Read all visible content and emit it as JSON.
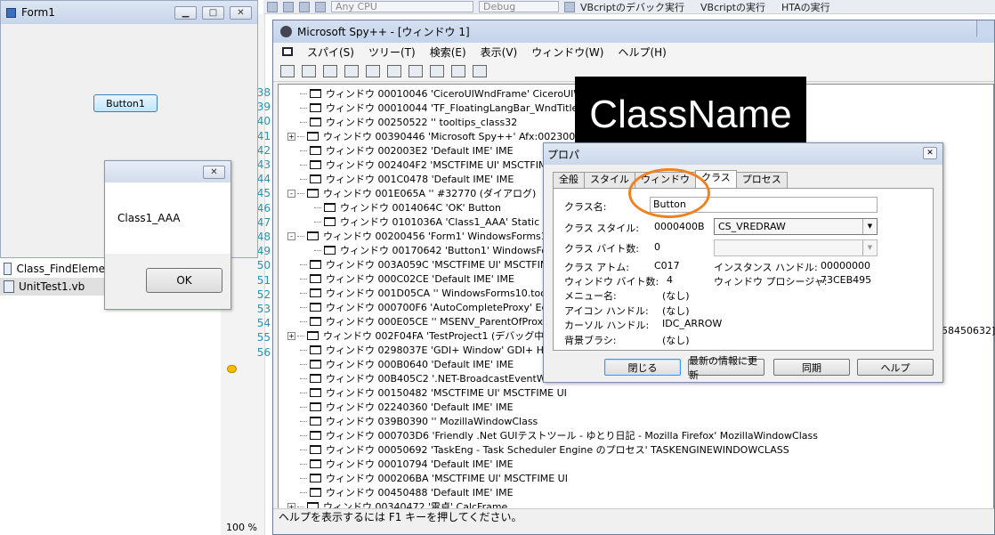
{
  "vs_toolbar": {
    "platform_combo": "Any CPU",
    "config_combo": "Debug",
    "commands": [
      "VBcriptのデバック実行",
      "VBcriptの実行",
      "HTAの実行"
    ]
  },
  "editor": {
    "line_numbers": [
      "38",
      "39",
      "40",
      "41",
      "42",
      "43",
      "44",
      "45",
      "46",
      "47",
      "48",
      "49",
      "50",
      "51",
      "52",
      "53",
      "54",
      "55",
      "56"
    ],
    "zoom": "100 %"
  },
  "form1": {
    "title": "Form1",
    "button_label": "Button1"
  },
  "solution": {
    "items": [
      "Class_FindEleme",
      "UnitTest1.vb"
    ]
  },
  "msgbox": {
    "message": "Class1_AAA",
    "ok_label": "OK"
  },
  "spy": {
    "title": "Microsoft Spy++ - [ウィンドウ 1]",
    "menu": [
      "スパイ(S)",
      "ツリー(T)",
      "検索(E)",
      "表示(V)",
      "ウィンドウ(W)",
      "ヘルプ(H)"
    ],
    "tree": [
      {
        "exp": "",
        "indent": 0,
        "text": "ウィンドウ 00010046 'CiceroUIWndFrame' CiceroUIWndF"
      },
      {
        "exp": "",
        "indent": 0,
        "text": "ウィンドウ 00010044 'TF_FloatingLangBar_WndTitle' Cic"
      },
      {
        "exp": "",
        "indent": 0,
        "text": "ウィンドウ 00250522 '' tooltips_class32"
      },
      {
        "exp": "+",
        "indent": 0,
        "text": "ウィンドウ 00390446 'Microsoft Spy++' Afx:00230000:8:0"
      },
      {
        "exp": "",
        "indent": 0,
        "text": "ウィンドウ 002003E2 'Default IME' IME"
      },
      {
        "exp": "",
        "indent": 0,
        "text": "ウィンドウ 002404F2 'MSCTFIME UI' MSCTFIME"
      },
      {
        "exp": "",
        "indent": 0,
        "text": "ウィンドウ 001C0478 'Default IME' IME"
      },
      {
        "exp": "-",
        "indent": 0,
        "text": "ウィンドウ 001E065A '' #32770 (ダイアログ)"
      },
      {
        "exp": "",
        "indent": 1,
        "text": "ウィンドウ 0014064C 'OK' Button"
      },
      {
        "exp": "",
        "indent": 1,
        "text": "ウィンドウ 0101036A 'Class1_AAA' Static"
      },
      {
        "exp": "-",
        "indent": 0,
        "text": "ウィンドウ 00200456 'Form1' WindowsForms10.W"
      },
      {
        "exp": "",
        "indent": 1,
        "text": "ウィンドウ 00170642 'Button1' WindowsForm"
      },
      {
        "exp": "",
        "indent": 0,
        "text": "ウィンドウ 003A059C 'MSCTFIME UI' MSCTFIME"
      },
      {
        "exp": "",
        "indent": 0,
        "text": "ウィンドウ 000C02CE 'Default IME' IME"
      },
      {
        "exp": "",
        "indent": 0,
        "text": "ウィンドウ 001D05CA '' WindowsForms10.tooltips"
      },
      {
        "exp": "",
        "indent": 0,
        "text": "ウィンドウ 000700F6 'AutoCompleteProxy' Edit"
      },
      {
        "exp": "",
        "indent": 0,
        "text": "ウィンドウ 000E05CE '' MSENV_ParentOfProxy"
      },
      {
        "exp": "+",
        "indent": 0,
        "text": "ウィンドウ 002F04FA 'TestProject1 (デバッグ中) -"
      },
      {
        "exp": "",
        "indent": 0,
        "text": "ウィンドウ 0298037E 'GDI+ Window' GDI+ Hook W"
      },
      {
        "exp": "",
        "indent": 0,
        "text": "ウィンドウ 000B0640 'Default IME' IME"
      },
      {
        "exp": "",
        "indent": 0,
        "text": "ウィンドウ 00B405C2 '.NET-BroadcastEventWind"
      },
      {
        "exp": "",
        "indent": 0,
        "text": "ウィンドウ 00150482 'MSCTFIME UI' MSCTFIME UI"
      },
      {
        "exp": "",
        "indent": 0,
        "text": "ウィンドウ 02240360 'Default IME' IME"
      },
      {
        "exp": "",
        "indent": 0,
        "text": "ウィンドウ 039B0390 '' MozillaWindowClass"
      },
      {
        "exp": "",
        "indent": 0,
        "text": "ウィンドウ 000703D6 'Friendly .Net GUIテストツール - ゆとり日記 - Mozilla Firefox' MozillaWindowClass"
      },
      {
        "exp": "",
        "indent": 0,
        "text": "ウィンドウ 00050692 'TaskEng - Task Scheduler Engine のプロセス' TASKENGINEWINDOWCLASS"
      },
      {
        "exp": "",
        "indent": 0,
        "text": "ウィンドウ 00010794 'Default IME' IME"
      },
      {
        "exp": "",
        "indent": 0,
        "text": "ウィンドウ 000206BA 'MSCTFIME UI' MSCTFIME UI"
      },
      {
        "exp": "",
        "indent": 0,
        "text": "ウィンドウ 00450488 'Default IME' IME"
      },
      {
        "exp": "+",
        "indent": 0,
        "text": "ウィンドウ 00340472 '電卓' CalcFrame"
      }
    ],
    "clipped_right_text": "58450632]",
    "status": "ヘルプを表示するには F1 キーを押してください。"
  },
  "banner": "ClassName",
  "prop": {
    "title": "プロパ",
    "tabs": [
      "全般",
      "スタイル",
      "ウィンドウ",
      "クラス",
      "プロセス"
    ],
    "active_tab": 3,
    "class_name_label": "クラス名:",
    "class_name_value": "Button",
    "class_style_label": "クラス スタイル:",
    "class_style_value": "0000400B",
    "class_style_combo": "CS_VREDRAW",
    "class_bytes_label": "クラス バイト数:",
    "class_bytes_value": "0",
    "class_atom_label": "クラス アトム:",
    "class_atom_value": "C017",
    "instance_handle_label": "インスタンス ハンドル:",
    "instance_handle_value": "00000000",
    "window_bytes_label": "ウィンドウ バイト数:",
    "window_bytes_value": "4",
    "window_proc_label": "ウィンドウ プロシージャ:",
    "window_proc_value": "73CEB495",
    "menu_name_label": "メニュー名:",
    "menu_name_value": "(なし)",
    "icon_handle_label": "アイコン ハンドル:",
    "icon_handle_value": "(なし)",
    "cursor_handle_label": "カーソル ハンドル:",
    "cursor_handle_value": "IDC_ARROW",
    "brush_label": "背景ブラシ:",
    "brush_value": "(なし)",
    "buttons": [
      "閉じる",
      "最新の情報に更新",
      "同期",
      "ヘルプ"
    ]
  }
}
